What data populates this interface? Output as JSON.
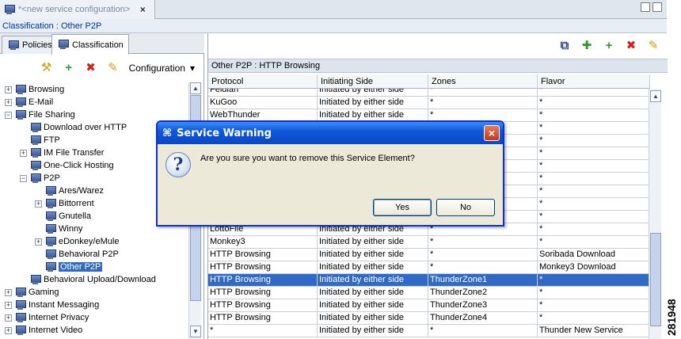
{
  "editor_tab": {
    "title": "*<new service configuration>",
    "close": "×"
  },
  "breadcrumb": "Classification : Other P2P",
  "left": {
    "tabs": [
      {
        "label": "Policies"
      },
      {
        "label": "Classification"
      }
    ],
    "toolbar": {
      "configuration_label": "Configuration"
    },
    "tree": [
      {
        "label": "Browsing",
        "depth": 0,
        "exp": "+"
      },
      {
        "label": "E-Mail",
        "depth": 0,
        "exp": "+"
      },
      {
        "label": "File Sharing",
        "depth": 0,
        "exp": "-"
      },
      {
        "label": "Download over HTTP",
        "depth": 1,
        "exp": ""
      },
      {
        "label": "FTP",
        "depth": 1,
        "exp": ""
      },
      {
        "label": "IM File Transfer",
        "depth": 1,
        "exp": "+"
      },
      {
        "label": "One-Click Hosting",
        "depth": 1,
        "exp": ""
      },
      {
        "label": "P2P",
        "depth": 1,
        "exp": "-"
      },
      {
        "label": "Ares/Warez",
        "depth": 2,
        "exp": ""
      },
      {
        "label": "Bittorrent",
        "depth": 2,
        "exp": "+"
      },
      {
        "label": "Gnutella",
        "depth": 2,
        "exp": ""
      },
      {
        "label": "Winny",
        "depth": 2,
        "exp": ""
      },
      {
        "label": "eDonkey/eMule",
        "depth": 2,
        "exp": "+"
      },
      {
        "label": "Behavioral P2P",
        "depth": 2,
        "exp": ""
      },
      {
        "label": "Other P2P",
        "depth": 2,
        "exp": "",
        "selected": true
      },
      {
        "label": "Behavioral Upload/Download",
        "depth": 1,
        "exp": ""
      },
      {
        "label": "Gaming",
        "depth": 0,
        "exp": "+"
      },
      {
        "label": "Instant Messaging",
        "depth": 0,
        "exp": "+"
      },
      {
        "label": "Internet Privacy",
        "depth": 0,
        "exp": "+"
      },
      {
        "label": "Internet Video",
        "depth": 0,
        "exp": "+"
      }
    ]
  },
  "right": {
    "table_title": "Other P2P : HTTP Browsing",
    "columns": [
      "Protocol",
      "Initiating Side",
      "Zones",
      "Flavor"
    ],
    "rows": [
      [
        "Feidian",
        "Initiated by either side",
        "*",
        "*"
      ],
      [
        "KuGoo",
        "Initiated by either side",
        "*",
        "*"
      ],
      [
        "WebThunder",
        "Initiated by either side",
        "*",
        "*"
      ],
      [
        "",
        "",
        "",
        "*"
      ],
      [
        "",
        "",
        "",
        "*"
      ],
      [
        "",
        "",
        "",
        "*"
      ],
      [
        "",
        "",
        "",
        "*"
      ],
      [
        "",
        "",
        "",
        "*"
      ],
      [
        "",
        "",
        "",
        "*"
      ],
      [
        "",
        "",
        "",
        "*"
      ],
      [
        "",
        "",
        "",
        "*"
      ],
      [
        "LottoFile",
        "Initiated by either side",
        "*",
        "*"
      ],
      [
        "Monkey3",
        "Initiated by either side",
        "*",
        "*"
      ],
      [
        "HTTP Browsing",
        "Initiated by either side",
        "*",
        "Soribada Download"
      ],
      [
        "HTTP Browsing",
        "Initiated by either side",
        "*",
        "Monkey3 Download"
      ],
      [
        "HTTP Browsing",
        "Initiated by either side",
        "ThunderZone1",
        "*"
      ],
      [
        "HTTP Browsing",
        "Initiated by either side",
        "ThunderZone2",
        "*"
      ],
      [
        "HTTP Browsing",
        "Initiated by either side",
        "ThunderZone3",
        "*"
      ],
      [
        "HTTP Browsing",
        "Initiated by either side",
        "ThunderZone4",
        "*"
      ],
      [
        "*",
        "Initiated by either side",
        "*",
        "Thunder New Service"
      ]
    ],
    "selected_row": 15
  },
  "dialog": {
    "title": "Service Warning",
    "message": "Are you sure you want to remove this Service Element?",
    "yes": "Yes",
    "no": "No",
    "close": "×"
  },
  "watermark": "281948"
}
